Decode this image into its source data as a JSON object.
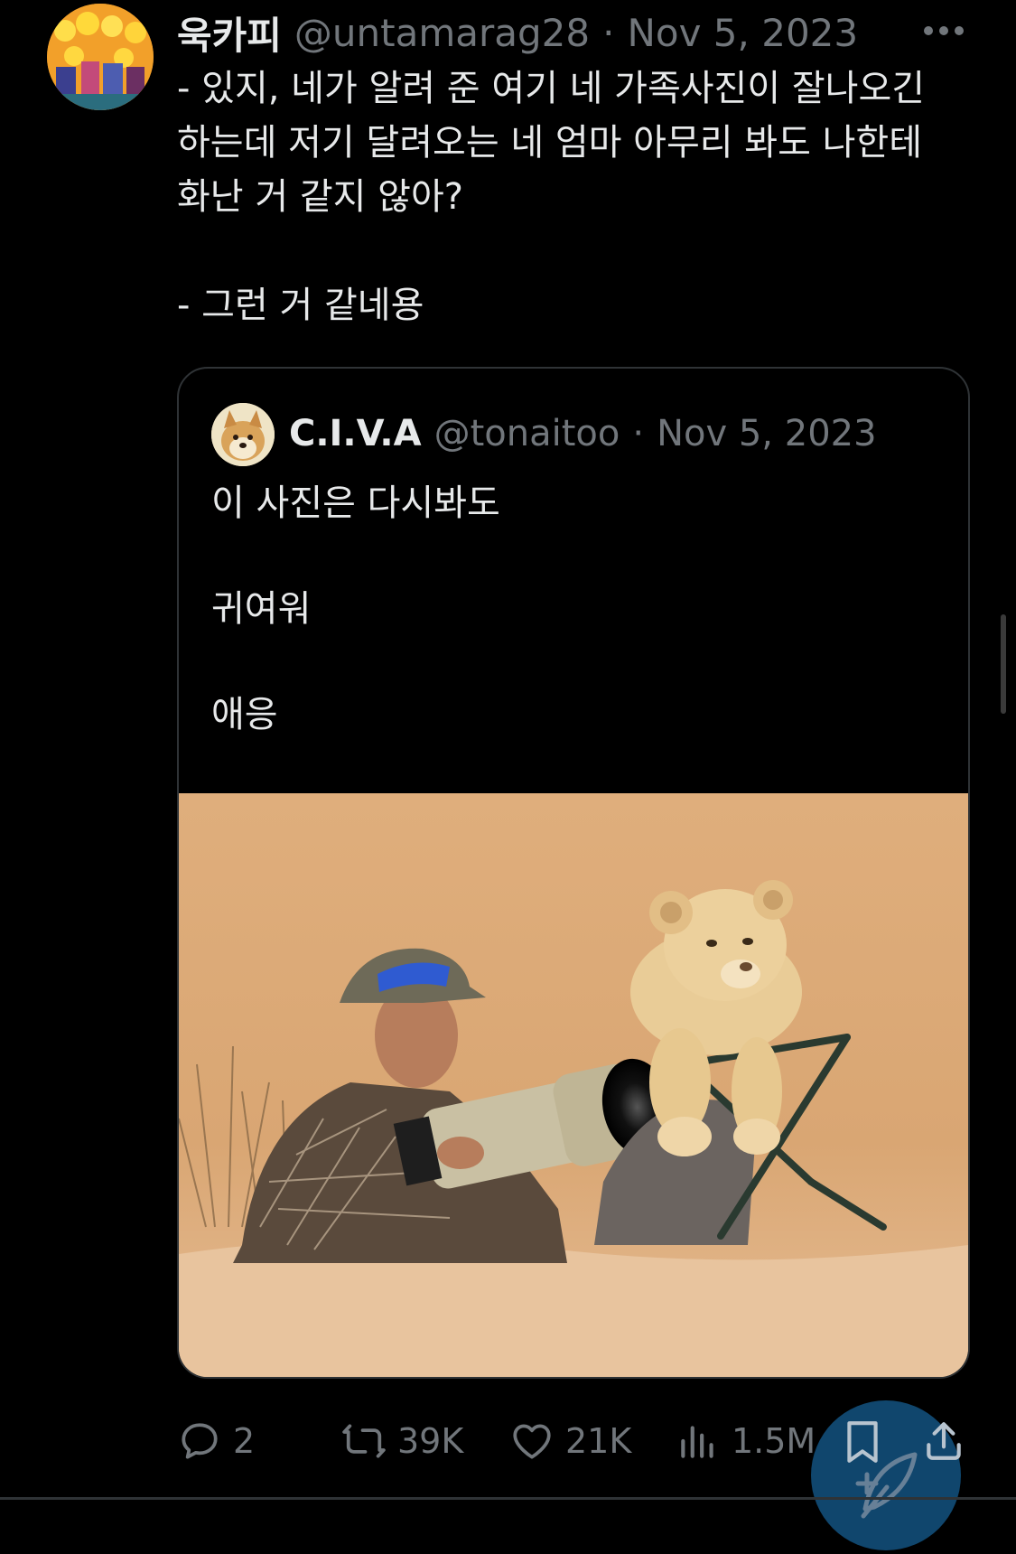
{
  "tweet": {
    "author_name": "욱카피",
    "handle": "@untamarag28",
    "separator": "·",
    "date": "Nov 5, 2023",
    "text_lines": [
      "- 있지, 네가 알려 준 여기 네 가족사진이 잘나오긴",
      "하는데 저기 달려오는 네 엄마 아무리 봐도 나한테",
      "화난 거 같지 않아?",
      "- 그런 거 같네용"
    ]
  },
  "quoted_tweet": {
    "author_name": "C.I.V.A",
    "handle": "@tonaitoo",
    "separator": "·",
    "date": "Nov 5, 2023",
    "text_lines": [
      "이 사진은 다시봐도",
      "귀여워",
      "애응"
    ]
  },
  "actions": {
    "replies": "2",
    "retweets": "39K",
    "likes": "21K",
    "views": "1.5M"
  },
  "colors": {
    "background": "#000000",
    "text": "#e7e9ea",
    "muted": "#71767b",
    "border": "#2f3336",
    "fab": "#114a73"
  },
  "icons": {
    "more": "more-horizontal-icon",
    "reply": "reply-icon",
    "retweet": "retweet-icon",
    "like": "heart-icon",
    "views": "views-icon",
    "bookmark": "bookmark-icon",
    "share": "share-icon",
    "compose": "feather-icon"
  }
}
